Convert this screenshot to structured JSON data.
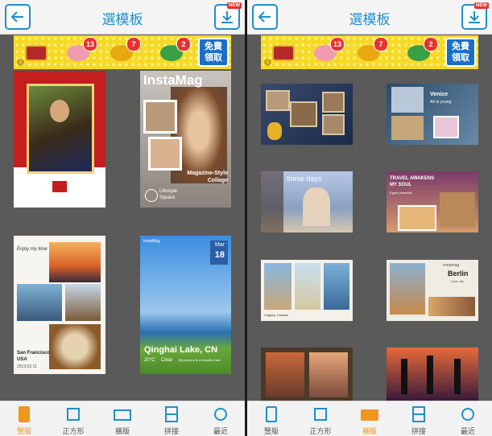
{
  "header": {
    "title": "選模板",
    "new_badge": "NEW"
  },
  "promo": {
    "items": [
      {
        "icon": "treasure-chest-icon",
        "count": ""
      },
      {
        "icon": "peach-icon",
        "count": "13"
      },
      {
        "icon": "gold-ingot-icon",
        "count": "7"
      },
      {
        "icon": "jade-gem-icon",
        "count": "2"
      }
    ],
    "free_label_line1": "免費",
    "free_label_line2": "領取",
    "info": "i"
  },
  "nav": {
    "items": [
      {
        "label": "豎版",
        "icon": "portrait-icon"
      },
      {
        "label": "正方形",
        "icon": "square-icon"
      },
      {
        "label": "橫版",
        "icon": "landscape-icon"
      },
      {
        "label": "拼接",
        "icon": "stitch-icon"
      },
      {
        "label": "最近",
        "icon": "recent-icon"
      }
    ],
    "left_active": "豎版",
    "right_active": "橫版"
  },
  "left_templates": {
    "instamag_title": "InstaMag",
    "instamag_subtitle_1": "Magazine-Style",
    "instamag_subtitle_2": "Collage",
    "instamag_lifestyle": "Lifestyle",
    "instamag_square": "Square",
    "sf_enjoy": "Enjoy my time",
    "sf_city": "San Francisco",
    "sf_country": "USA",
    "sf_date": "2013.03.11",
    "qh_month": "Mar",
    "qh_day": "18",
    "qh_title": "Qinghai Lake, CN",
    "qh_weather": "Clear",
    "qh_note": "My journey to a beautiful lake",
    "qh_temp": "20°C",
    "qh_brand": "InstaMag"
  },
  "right_templates": {
    "venice_title": "Venice",
    "venice_sub": "Art is young",
    "these_days": "these days",
    "travel_title_1": "TRAVEL AWAKENS",
    "travel_title_2": "MY SOUL",
    "travel_sub": "Egypt pyramids",
    "berlin_brand": "instamag",
    "berlin_title": "Berlin",
    "berlin_sub": "Dear city",
    "calgary_caption": "Calgary, Canada"
  }
}
